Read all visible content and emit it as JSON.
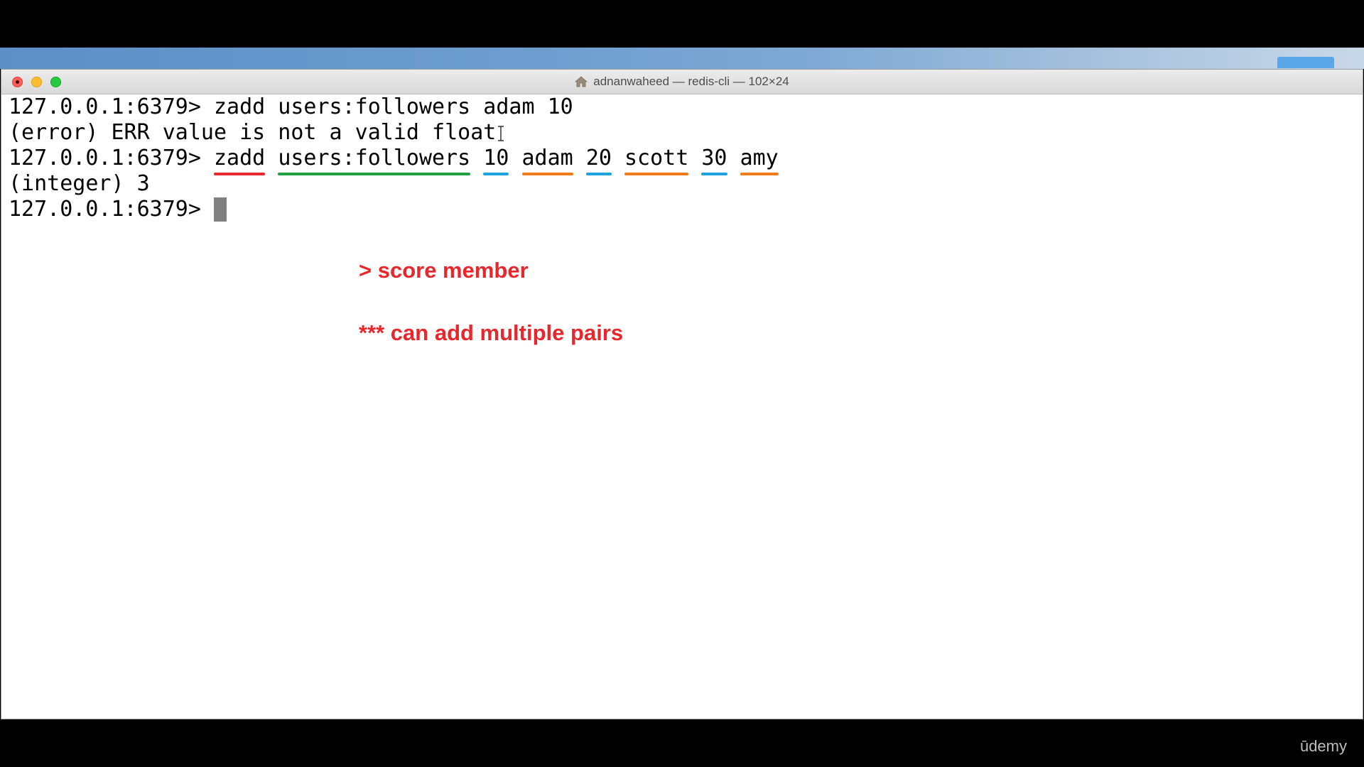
{
  "window": {
    "title": "adnanwaheed — redis-cli — 102×24"
  },
  "terminal": {
    "lines": [
      {
        "prompt": "127.0.0.1:6379>",
        "command": "zadd users:followers adam 10"
      },
      {
        "output": "(error) ERR value is not a valid float"
      },
      {
        "prompt": "127.0.0.1:6379>",
        "tokens": [
          "zadd",
          "users:followers",
          "10",
          "adam",
          "20",
          "scott",
          "30",
          "amy"
        ]
      },
      {
        "output": "(integer) 3"
      },
      {
        "prompt": "127.0.0.1:6379>"
      }
    ]
  },
  "annotations": {
    "note1": "> score member",
    "note2": "*** can add multiple pairs",
    "colors": {
      "command": "#e52b2b",
      "key": "#20a040",
      "score": "#1fa2de",
      "member": "#f07c1c",
      "note_text": "#e8262c"
    }
  },
  "watermark": "ūdemy",
  "icons": {
    "title_icon": "home-icon",
    "text_cursor": "ibeam-cursor-icon"
  }
}
